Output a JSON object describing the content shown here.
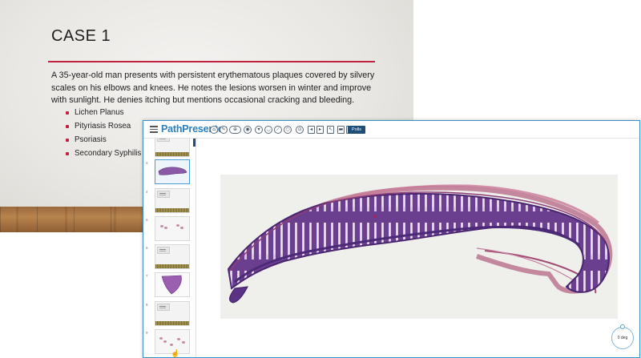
{
  "slide": {
    "title": "CASE 1",
    "body": "A 35-year-old man presents with persistent erythematous plaques covered by silvery scales on his elbows and knees. He notes the lesions worsen in winter and improve with sunlight. He denies itching but mentions occasional cracking and bleeding.",
    "options": [
      "Lichen Planus",
      "Pityriasis Rosea",
      "Psoriasis",
      "Secondary Syphilis"
    ],
    "accent_color": "#c2203f"
  },
  "viewer": {
    "app_name": "PathPresenter",
    "menu_icon": "hamburger-menu-icon",
    "brand_color": "#2a7fc0",
    "toolbar_tools": [
      {
        "name": "home-icon",
        "glyph": "⌂"
      },
      {
        "name": "draw-icon",
        "glyph": "✎"
      },
      {
        "name": "zoom-icon",
        "glyph": "⊕"
      },
      {
        "name": "camera-icon",
        "glyph": "◉"
      },
      {
        "name": "pin-icon",
        "glyph": "▾"
      },
      {
        "name": "ruler-icon",
        "glyph": "◡"
      },
      {
        "name": "measure-icon",
        "glyph": "⟋"
      },
      {
        "name": "circle-icon",
        "glyph": "○"
      },
      {
        "name": "settings-icon",
        "glyph": "⊙"
      },
      {
        "name": "prev-slide-icon",
        "glyph": "◂"
      },
      {
        "name": "next-slide-icon",
        "glyph": "▸"
      },
      {
        "name": "pointer-icon",
        "glyph": "↖"
      },
      {
        "name": "chat-icon",
        "glyph": "▬"
      },
      {
        "name": "stop-icon",
        "glyph": "■"
      }
    ],
    "polls_label": "Polls",
    "thumbnails": [
      {
        "num": "",
        "kind": "label"
      },
      {
        "num": "3",
        "kind": "tissue-active"
      },
      {
        "num": "4",
        "kind": "label"
      },
      {
        "num": "5",
        "kind": "dots"
      },
      {
        "num": "6",
        "kind": "label"
      },
      {
        "num": "7",
        "kind": "tissue-fan"
      },
      {
        "num": "8",
        "kind": "label"
      },
      {
        "num": "9",
        "kind": "dots"
      }
    ],
    "rotation_label": "0 deg"
  }
}
